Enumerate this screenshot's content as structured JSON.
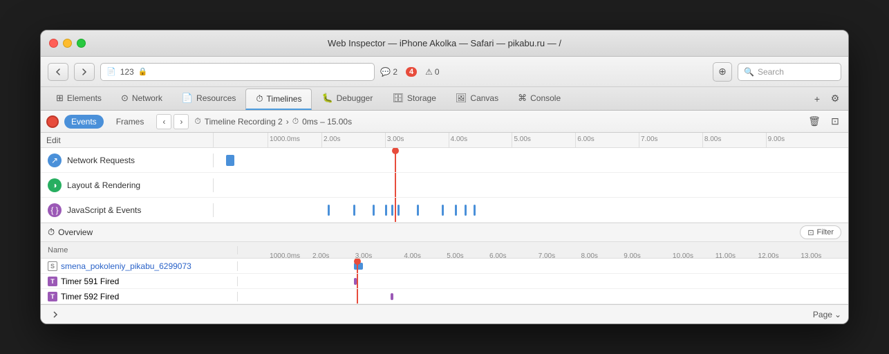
{
  "window": {
    "title": "Web Inspector — iPhone Akolka — Safari — pikabu.ru — /"
  },
  "toolbar": {
    "url_count": "123",
    "message_count": "2",
    "error_count": "4",
    "warning_count": "0",
    "search_placeholder": "Search"
  },
  "devtools_tabs": [
    {
      "id": "elements",
      "label": "Elements",
      "icon": "⊞"
    },
    {
      "id": "network",
      "label": "Network",
      "icon": "⊙"
    },
    {
      "id": "resources",
      "label": "Resources",
      "icon": "📄"
    },
    {
      "id": "timelines",
      "label": "Timelines",
      "icon": "⏱"
    },
    {
      "id": "debugger",
      "label": "Debugger",
      "icon": "🐛"
    },
    {
      "id": "storage",
      "label": "Storage",
      "icon": "🗄"
    },
    {
      "id": "canvas",
      "label": "Canvas",
      "icon": "🖼"
    },
    {
      "id": "console",
      "label": "Console",
      "icon": "⌘"
    }
  ],
  "timeline": {
    "recording_label": "Events",
    "frames_label": "Frames",
    "recording_name": "Timeline Recording 2",
    "time_range": "0ms – 15.00s",
    "overview_label": "Overview",
    "filter_label": "Filter"
  },
  "ruler_ticks": [
    {
      "label": "1000.0ms",
      "pct": 8.5
    },
    {
      "label": "2.00s",
      "pct": 17
    },
    {
      "label": "3.00s",
      "pct": 27
    },
    {
      "label": "4.00s",
      "pct": 37
    },
    {
      "label": "5.00s",
      "pct": 47
    },
    {
      "label": "6.00s",
      "pct": 57
    },
    {
      "label": "7.00s",
      "pct": 67
    },
    {
      "label": "8.00s",
      "pct": 77
    },
    {
      "label": "9.00s",
      "pct": 87
    }
  ],
  "overview_ruler_ticks": [
    {
      "label": "1000.0ms",
      "pct": 5
    },
    {
      "label": "2.00s",
      "pct": 12
    },
    {
      "label": "3.00s",
      "pct": 19
    },
    {
      "label": "4.00s",
      "pct": 27
    },
    {
      "label": "5.00s",
      "pct": 34
    },
    {
      "label": "6.00s",
      "pct": 41
    },
    {
      "label": "7.00s",
      "pct": 49
    },
    {
      "label": "8.00s",
      "pct": 56
    },
    {
      "label": "9.00s",
      "pct": 63
    },
    {
      "label": "10.00s",
      "pct": 71
    },
    {
      "label": "11.00s",
      "pct": 78
    },
    {
      "label": "12.00s",
      "pct": 85
    },
    {
      "label": "13.00s",
      "pct": 92
    }
  ],
  "timeline_rows": [
    {
      "id": "network",
      "label": "Network Requests",
      "icon": "↗",
      "icon_class": "icon-network"
    },
    {
      "id": "layout",
      "label": "Layout & Rendering",
      "icon": "⬒",
      "icon_class": "icon-layout"
    },
    {
      "id": "js",
      "label": "JavaScript & Events",
      "icon": "{ }",
      "icon_class": "icon-js"
    }
  ],
  "table": {
    "col_name": "Name",
    "rows": [
      {
        "id": "row1",
        "name": "smena_pokoleniy_pikabu_6299073",
        "type": "script",
        "is_link": true,
        "bar_color": "#4a90d9",
        "bar_left_pct": 19,
        "bar_width_pct": 1.5
      },
      {
        "id": "row2",
        "name": "Timer 591 Fired",
        "type": "timer",
        "is_link": false,
        "bar_color": "#9b59b6",
        "bar_left_pct": 19,
        "bar_width_pct": 0.5
      },
      {
        "id": "row3",
        "name": "Timer 592 Fired",
        "type": "timer",
        "is_link": false,
        "bar_color": "#9b59b6",
        "bar_left_pct": 25,
        "bar_width_pct": 0.5
      }
    ]
  },
  "bottom": {
    "page_label": "Page"
  }
}
